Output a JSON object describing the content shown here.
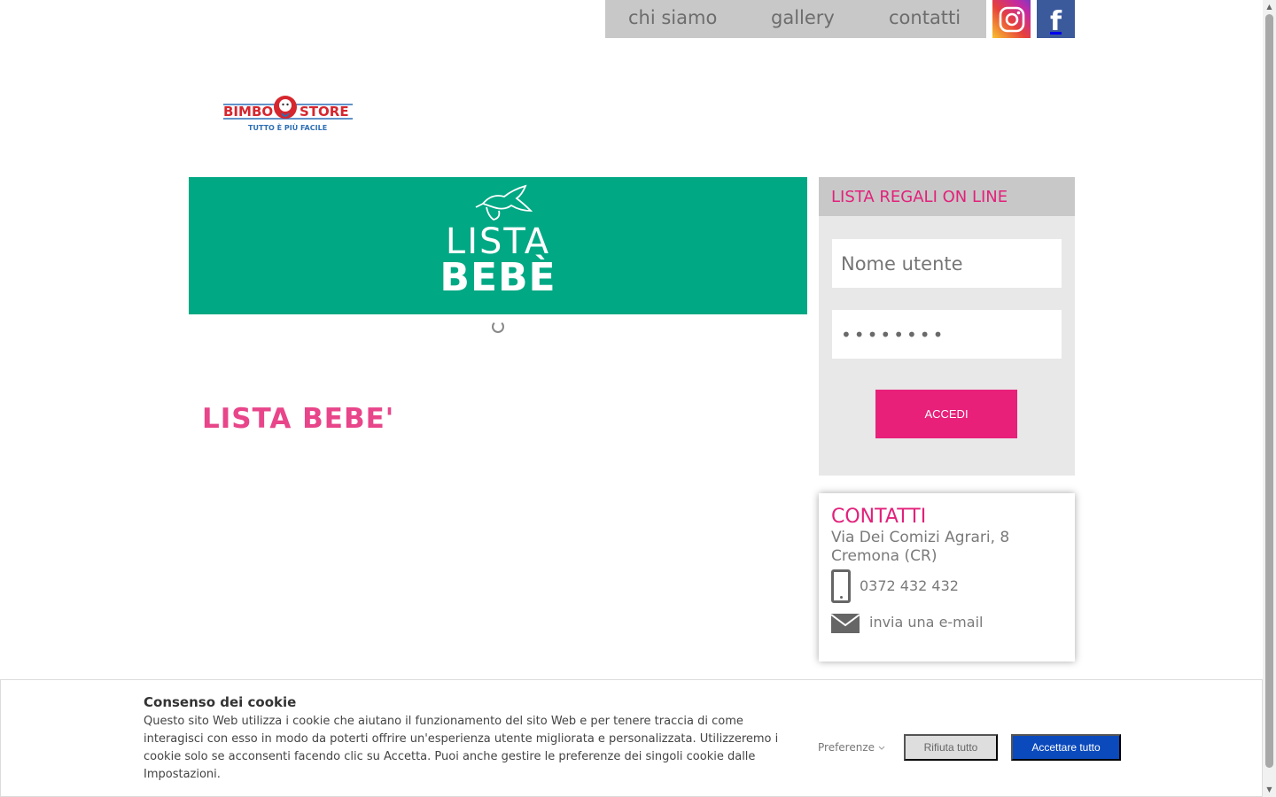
{
  "nav": {
    "items": [
      "chi siamo",
      "gallery",
      "contatti"
    ],
    "social": {
      "instagram": "instagram-icon",
      "facebook": "facebook-icon",
      "facebook_glyph": "f"
    }
  },
  "logo": {
    "name": "BIMBO STORE",
    "left": "BIMBO",
    "right": "STORE",
    "tagline": "TUTTO È PIÙ FACILE"
  },
  "banner": {
    "line1": "LISTA",
    "line2": "BEBÈ",
    "color": "#00a884"
  },
  "main": {
    "title": "LISTA BEBE'"
  },
  "login": {
    "title": "LISTA REGALI ON LINE",
    "username_placeholder": "Nome utente",
    "password_value": "••••••••",
    "submit_label": "ACCEDI"
  },
  "contacts": {
    "title": "CONTATTI",
    "address_line1": "Via Dei Comizi Agrari, 8",
    "address_line2": "Cremona (CR)",
    "phone": "0372 432 432",
    "email_label": "invia una e-mail"
  },
  "cookie": {
    "title": "Consenso dei cookie",
    "text": "Questo sito Web utilizza i cookie che aiutano il funzionamento del sito Web e per tenere traccia di come interagisci con esso in modo da poterti offrire un'esperienza utente migliorata e personalizzata. Utilizzeremo i cookie solo se acconsenti facendo clic su Accetta. Puoi anche gestire le preferenze dei singoli cookie dalle Impostazioni.",
    "preferences_label": "Preferenze",
    "reject_label": "Rifiuta tutto",
    "accept_label": "Accettare tutto"
  },
  "colors": {
    "accent_pink": "#e2217a",
    "accept_blue": "#0b4abd",
    "banner_green": "#00a884"
  }
}
